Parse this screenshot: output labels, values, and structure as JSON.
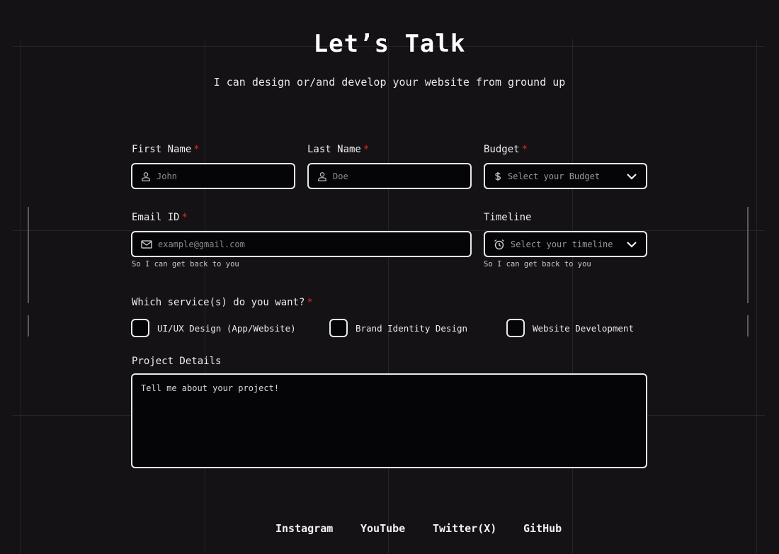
{
  "header": {
    "title": "Let’s Talk",
    "subtitle": "I can design or/and develop your website from ground up"
  },
  "form": {
    "required_marker": "*",
    "first_name": {
      "label": "First Name",
      "placeholder": "John",
      "icon": "user-icon"
    },
    "last_name": {
      "label": "Last Name",
      "placeholder": "Doe",
      "icon": "user-icon"
    },
    "budget": {
      "label": "Budget",
      "placeholder": "Select your Budget",
      "icon": "dollar-icon"
    },
    "email": {
      "label": "Email ID",
      "placeholder": "example@gmail.com",
      "icon": "mail-icon",
      "hint": "So I can get back to you"
    },
    "timeline": {
      "label": "Timeline",
      "placeholder": "Select your timeline",
      "icon": "alarm-clock-icon",
      "hint": "So I can get back to you"
    },
    "services": {
      "label": "Which service(s) do you want?",
      "options": [
        {
          "label": "UI/UX Design (App/Website)",
          "checked": false
        },
        {
          "label": "Brand Identity Design",
          "checked": false
        },
        {
          "label": "Website Development",
          "checked": false
        }
      ]
    },
    "project": {
      "label": "Project Details",
      "placeholder": "Tell me about your project!"
    }
  },
  "footer": {
    "links": [
      "Instagram",
      "YouTube",
      "Twitter(X)",
      "GitHub"
    ]
  },
  "colors": {
    "background": "#141215",
    "field_background": "#050406",
    "border": "#e9e9e9",
    "required": "#e0242c"
  }
}
